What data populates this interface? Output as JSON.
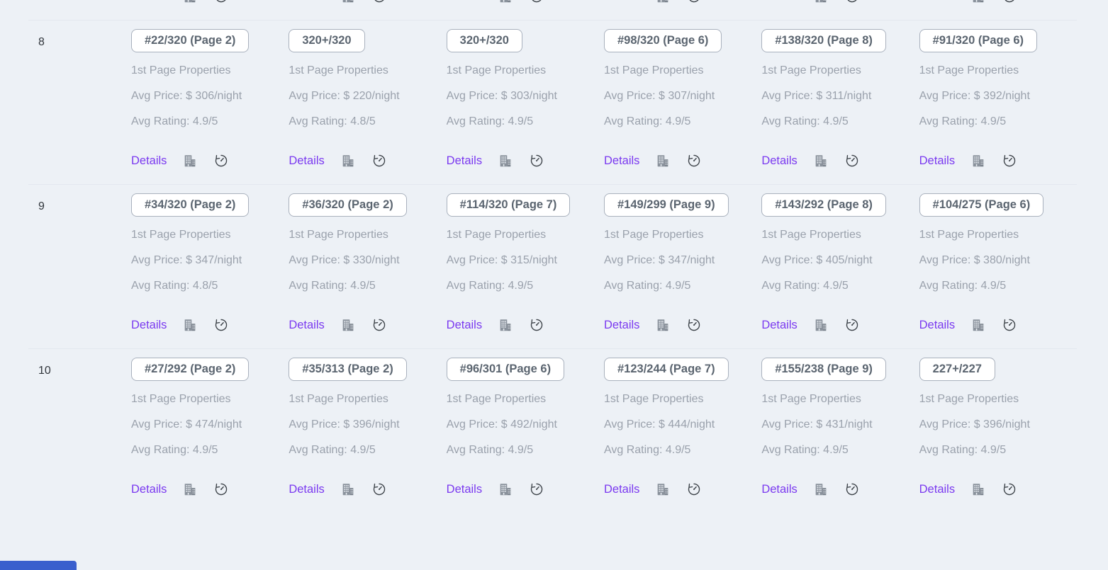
{
  "strings": {
    "subtitle": "1st Page Properties",
    "details_label": "Details"
  },
  "colors": {
    "page_background": "#edf1f6",
    "link_purple": "#7b3af0",
    "badge_border": "#a9b1bd",
    "badge_text": "#5b6570",
    "muted_text": "#9aa1ac",
    "separator": "#e3e8ef",
    "icon_gray": "#8a929c",
    "icon_dark": "#3d4349",
    "status_bar_blue": "#3a5fcd"
  },
  "icons": {
    "building": "building-icon",
    "clock": "history-clock-icon"
  },
  "rows": [
    {
      "label": "8",
      "cells": [
        {
          "badge": "#22/320 (Page 2)",
          "price_text": "Avg Price: $ 306/night",
          "rating_text": "Avg Rating: 4.9/5"
        },
        {
          "badge": "320+/320",
          "price_text": "Avg Price: $ 220/night",
          "rating_text": "Avg Rating: 4.8/5"
        },
        {
          "badge": "320+/320",
          "price_text": "Avg Price: $ 303/night",
          "rating_text": "Avg Rating: 4.9/5"
        },
        {
          "badge": "#98/320 (Page 6)",
          "price_text": "Avg Price: $ 307/night",
          "rating_text": "Avg Rating: 4.9/5"
        },
        {
          "badge": "#138/320 (Page 8)",
          "price_text": "Avg Price: $ 311/night",
          "rating_text": "Avg Rating: 4.9/5"
        },
        {
          "badge": "#91/320 (Page 6)",
          "price_text": "Avg Price: $ 392/night",
          "rating_text": "Avg Rating: 4.9/5"
        }
      ]
    },
    {
      "label": "9",
      "cells": [
        {
          "badge": "#34/320 (Page 2)",
          "price_text": "Avg Price: $ 347/night",
          "rating_text": "Avg Rating: 4.8/5"
        },
        {
          "badge": "#36/320 (Page 2)",
          "price_text": "Avg Price: $ 330/night",
          "rating_text": "Avg Rating: 4.9/5"
        },
        {
          "badge": "#114/320 (Page 7)",
          "price_text": "Avg Price: $ 315/night",
          "rating_text": "Avg Rating: 4.9/5"
        },
        {
          "badge": "#149/299 (Page 9)",
          "price_text": "Avg Price: $ 347/night",
          "rating_text": "Avg Rating: 4.9/5"
        },
        {
          "badge": "#143/292 (Page 8)",
          "price_text": "Avg Price: $ 405/night",
          "rating_text": "Avg Rating: 4.9/5"
        },
        {
          "badge": "#104/275 (Page 6)",
          "price_text": "Avg Price: $ 380/night",
          "rating_text": "Avg Rating: 4.9/5"
        }
      ]
    },
    {
      "label": "10",
      "cells": [
        {
          "badge": "#27/292 (Page 2)",
          "price_text": "Avg Price: $ 474/night",
          "rating_text": "Avg Rating: 4.9/5"
        },
        {
          "badge": "#35/313 (Page 2)",
          "price_text": "Avg Price: $ 396/night",
          "rating_text": "Avg Rating: 4.9/5"
        },
        {
          "badge": "#96/301 (Page 6)",
          "price_text": "Avg Price: $ 492/night",
          "rating_text": "Avg Rating: 4.9/5"
        },
        {
          "badge": "#123/244 (Page 7)",
          "price_text": "Avg Price: $ 444/night",
          "rating_text": "Avg Rating: 4.9/5"
        },
        {
          "badge": "#155/238 (Page 9)",
          "price_text": "Avg Price: $ 431/night",
          "rating_text": "Avg Rating: 4.9/5"
        },
        {
          "badge": "227+/227",
          "price_text": "Avg Price: $ 396/night",
          "rating_text": "Avg Rating: 4.9/5"
        }
      ]
    }
  ]
}
